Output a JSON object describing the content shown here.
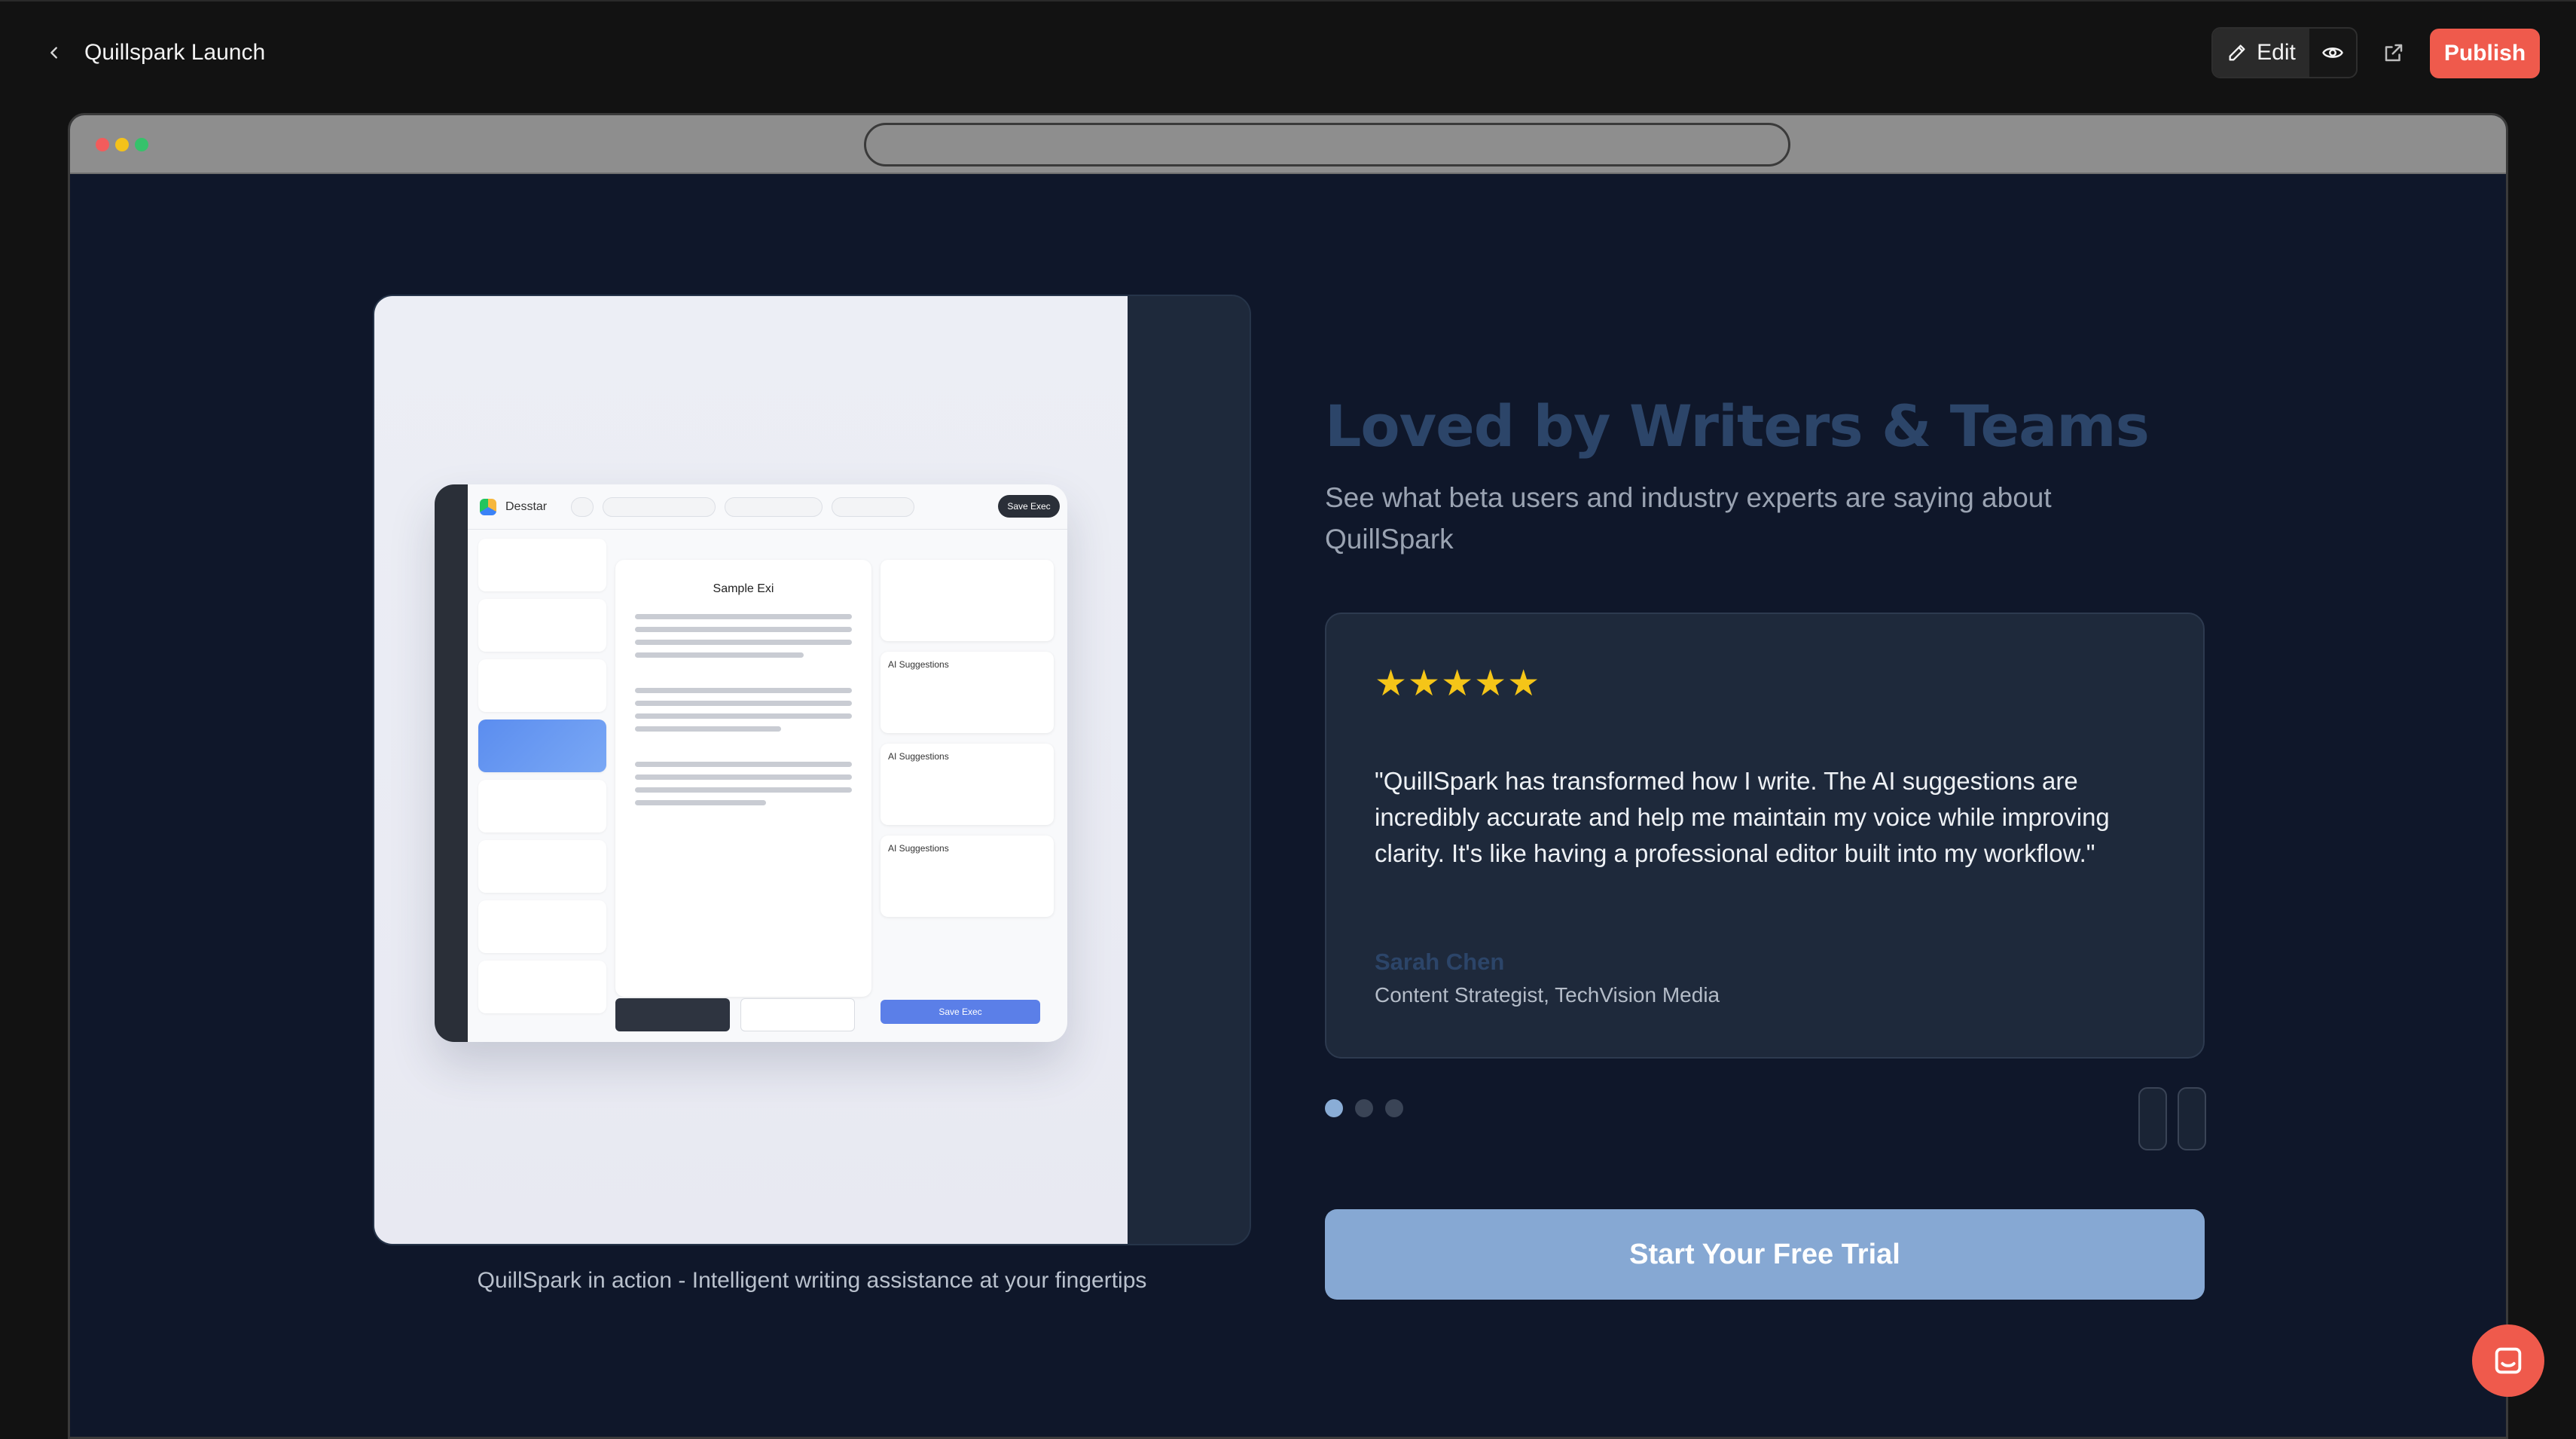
{
  "header": {
    "title": "Quillspark Launch",
    "edit_label": "Edit",
    "publish_label": "Publish"
  },
  "hero": {
    "caption": "QuillSpark in action - Intelligent writing assistance at your fingertips",
    "mockup": {
      "brand": "Desstar",
      "doc_title": "Sample Exi",
      "save_label": "Save Exec",
      "suggestions_label": "AI Suggestions"
    }
  },
  "testimonials": {
    "headline": "Loved by Writers & Teams",
    "subheadline": "See what beta users and industry experts are saying about QuillSpark",
    "current": {
      "stars": "★★★★★",
      "rating": 5,
      "quote": "\"QuillSpark has transformed how I write. The AI suggestions are incredibly accurate and help me maintain my voice while improving clarity. It's like having a professional editor built into my workflow.\"",
      "author": "Sarah Chen",
      "role": "Content Strategist, TechVision Media"
    },
    "page_count": 3,
    "active_page": 1
  },
  "cta": {
    "label": "Start Your Free Trial"
  },
  "colors": {
    "accent": "#ef5a4c",
    "page_bg": "#0f172a",
    "card_bg": "#1e293b",
    "headline": "#2c4569",
    "cta_bg": "#86a8d3",
    "star": "#f5c518"
  }
}
